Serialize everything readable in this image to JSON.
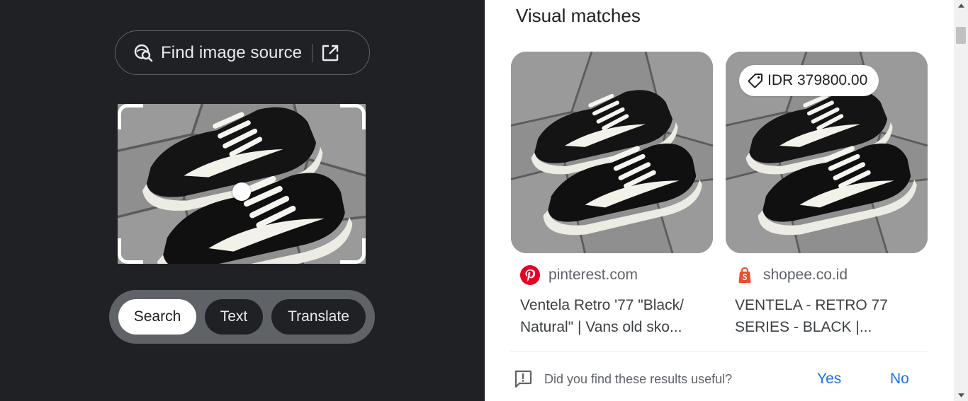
{
  "lens": {
    "find_source_label": "Find image source",
    "icons": {
      "find_source": "lens-search-icon",
      "open_external": "open-in-new-icon",
      "drag_handle": "drag-handle-dot"
    },
    "modes": [
      {
        "label": "Search",
        "active": true
      },
      {
        "label": "Text",
        "active": false
      },
      {
        "label": "Translate",
        "active": false
      }
    ]
  },
  "results": {
    "section_title": "Visual matches",
    "cards": [
      {
        "site": "pinterest.com",
        "site_icon": "pinterest-icon",
        "title": "Ventela Retro '77 \"Black/ Natural\" | Vans old sko...",
        "price": ""
      },
      {
        "site": "shopee.co.id",
        "site_icon": "shopee-bag-icon",
        "title": "VENTELA - RETRO 77 SERIES - BLACK |...",
        "price": "IDR 379800.00",
        "price_icon": "price-tag-icon"
      }
    ],
    "feedback": {
      "question": "Did you find these results useful?",
      "yes": "Yes",
      "no": "No",
      "icon": "feedback-icon"
    }
  },
  "colors": {
    "left_panel_bg": "#202124",
    "accent_link": "#1a73e8",
    "pinterest_red": "#e60023",
    "shopee_orange": "#ee4d2d"
  }
}
